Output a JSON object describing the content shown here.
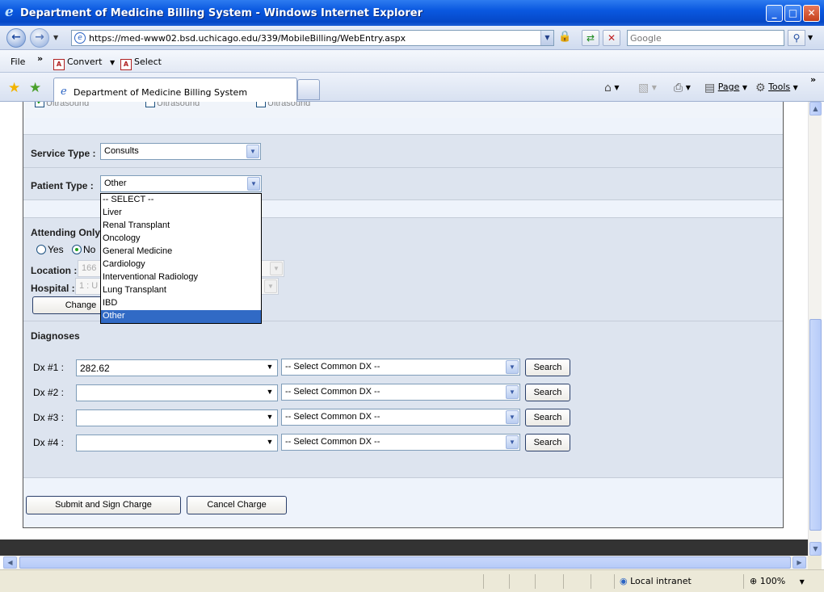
{
  "window": {
    "title": "Department of Medicine Billing System - Windows Internet Explorer",
    "minimize": "_",
    "maximize": "□",
    "close": "✕"
  },
  "address_bar": {
    "url": "https://med-www02.bsd.uchicago.edu/339/MobileBilling/WebEntry.aspx",
    "search_placeholder": "Google"
  },
  "menu": {
    "file": "File",
    "more": "»",
    "convert": "Convert",
    "select": "Select"
  },
  "tabs": {
    "active_tab": "Department of Medicine Billing System"
  },
  "command_bar": {
    "page": "Page",
    "tools": "Tools",
    "more": "»"
  },
  "form": {
    "imaging_checkboxes": [
      {
        "label": "Ultrasound",
        "checked": true
      },
      {
        "label": "Ultrasound",
        "checked": false
      },
      {
        "label": "Ultrasound",
        "checked": false
      }
    ],
    "service_type": {
      "label": "Service Type :",
      "value": "Consults"
    },
    "patient_type": {
      "label": "Patient Type :",
      "value": "Other",
      "options": [
        "-- SELECT --",
        "Liver",
        "Renal Transplant",
        "Oncology",
        "General Medicine",
        "Cardiology",
        "Interventional Radiology",
        "Lung Transplant",
        "IBD",
        "Other"
      ],
      "selected": "Other"
    },
    "attending_only": {
      "label": "Attending Only",
      "yes": "Yes",
      "no": "No",
      "selected": "No"
    },
    "location": {
      "label": "Location :",
      "value": "166"
    },
    "hospital": {
      "label": "Hospital :",
      "value": "1 : U"
    },
    "change_button": "Change",
    "diagnoses": {
      "heading": "Diagnoses",
      "rows": [
        {
          "label": "Dx #1 :",
          "value": "282.62",
          "common": "-- Select Common DX --",
          "search": "Search"
        },
        {
          "label": "Dx #2 :",
          "value": "",
          "common": "-- Select Common DX --",
          "search": "Search"
        },
        {
          "label": "Dx #3 :",
          "value": "",
          "common": "-- Select Common DX --",
          "search": "Search"
        },
        {
          "label": "Dx #4 :",
          "value": "",
          "common": "-- Select Common DX --",
          "search": "Search"
        }
      ]
    },
    "submit_button": "Submit and Sign Charge",
    "cancel_button": "Cancel Charge"
  },
  "status_bar": {
    "zone": "Local intranet",
    "zoom": "100%"
  }
}
